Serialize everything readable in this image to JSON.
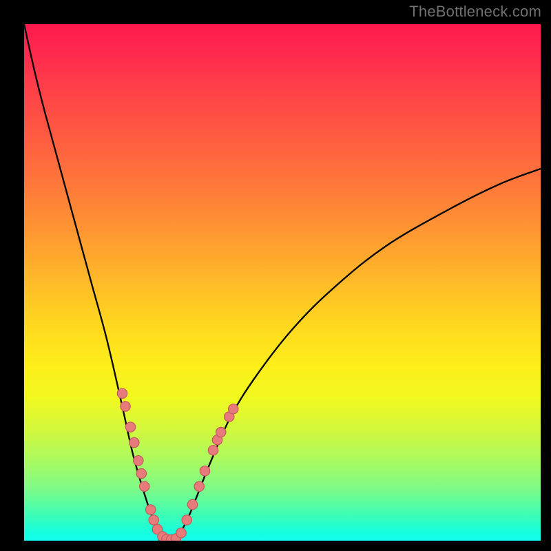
{
  "watermark": "TheBottleneck.com",
  "colors": {
    "background": "#000000",
    "watermark": "#6f6f6f",
    "curve": "#0a0a0a",
    "dot_fill": "#e77a7b",
    "dot_stroke": "#c25a5c"
  },
  "chart_data": {
    "type": "line",
    "title": "",
    "xlabel": "",
    "ylabel": "",
    "xlim": [
      0,
      100
    ],
    "ylim": [
      0,
      100
    ],
    "grid": false,
    "legend": false,
    "note": "Axes are unitless percentage-like scales inferred from pixel positions (no printed tick labels). y values are bottleneck-magnitude style: high at edges, ~0 near x≈27.",
    "series": [
      {
        "name": "left-branch",
        "x": [
          0,
          2,
          4,
          7,
          10,
          13,
          16,
          19,
          21,
          23,
          25,
          26.5,
          27.5
        ],
        "y": [
          100,
          91,
          83,
          72,
          61,
          50,
          39,
          26,
          17,
          10,
          4,
          1,
          0
        ]
      },
      {
        "name": "right-branch",
        "x": [
          29,
          30.5,
          32,
          34,
          36,
          40,
          45,
          52,
          60,
          70,
          82,
          92,
          100
        ],
        "y": [
          0,
          2,
          5,
          10,
          15,
          24,
          32,
          41,
          49,
          57,
          64,
          69,
          72
        ]
      }
    ],
    "valley_flat": {
      "x_start": 26,
      "x_end": 30,
      "y": 0
    },
    "markers": {
      "name": "salmon-dots",
      "points": [
        {
          "x": 19.0,
          "y": 28.5
        },
        {
          "x": 19.6,
          "y": 26.0
        },
        {
          "x": 20.6,
          "y": 22.0
        },
        {
          "x": 21.3,
          "y": 19.0
        },
        {
          "x": 22.1,
          "y": 15.5
        },
        {
          "x": 22.7,
          "y": 13.0
        },
        {
          "x": 23.3,
          "y": 10.5
        },
        {
          "x": 24.5,
          "y": 6.0
        },
        {
          "x": 25.1,
          "y": 4.0
        },
        {
          "x": 25.8,
          "y": 2.2
        },
        {
          "x": 26.8,
          "y": 0.8
        },
        {
          "x": 27.6,
          "y": 0.3
        },
        {
          "x": 28.5,
          "y": 0.2
        },
        {
          "x": 29.4,
          "y": 0.4
        },
        {
          "x": 30.4,
          "y": 1.5
        },
        {
          "x": 31.5,
          "y": 4.0
        },
        {
          "x": 32.6,
          "y": 7.0
        },
        {
          "x": 33.9,
          "y": 10.5
        },
        {
          "x": 35.0,
          "y": 13.5
        },
        {
          "x": 36.6,
          "y": 17.5
        },
        {
          "x": 37.4,
          "y": 19.5
        },
        {
          "x": 38.1,
          "y": 21.0
        },
        {
          "x": 39.7,
          "y": 24.0
        },
        {
          "x": 40.5,
          "y": 25.5
        }
      ]
    }
  }
}
